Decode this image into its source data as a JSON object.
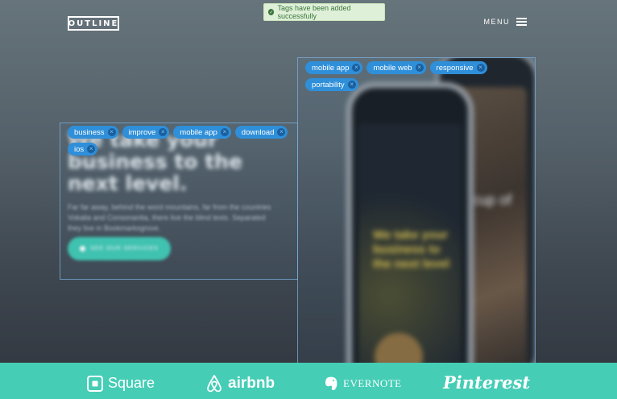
{
  "header": {
    "logo": "OUTLINE",
    "menu_label": "MENU"
  },
  "toast": {
    "message": "Tags have been added successfully"
  },
  "hero": {
    "title": "We take your business to the next level.",
    "body": "Far far away, behind the word mountains, far from the countries Vokalia and Consonantia, there live the blind texts. Separated they live in Bookmarksgrove.",
    "cta_label": "SEE OUR SERVICES"
  },
  "phones": {
    "front_screen_text": "We take your business to the next level",
    "back_screen_text": "cup of"
  },
  "tag_groups": [
    {
      "tags": [
        "business",
        "improve",
        "mobile app",
        "download",
        "ios"
      ]
    },
    {
      "tags": [
        "mobile app",
        "mobile web",
        "responsive",
        "portability"
      ]
    }
  ],
  "footer": {
    "brands": [
      "Square",
      "airbnb",
      "EVERNOTE",
      "Pinterest"
    ]
  },
  "colors": {
    "tag": "#2f8fd9",
    "footer": "#45cdb6",
    "toast_bg": "#dff0d8",
    "cta": "#3fc6b0"
  }
}
